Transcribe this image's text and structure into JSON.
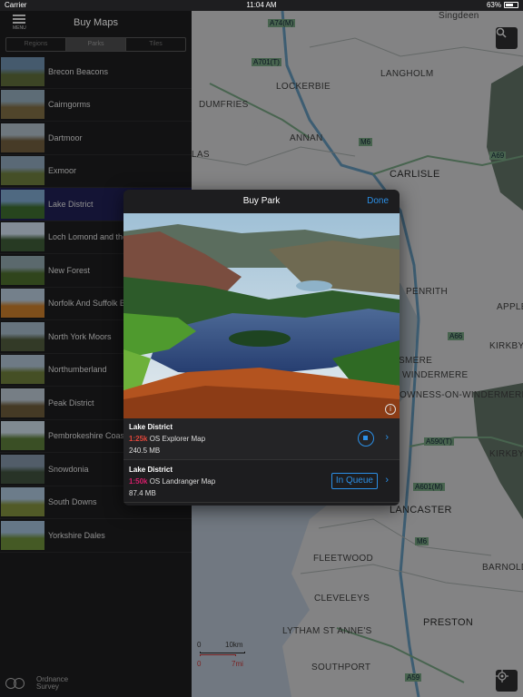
{
  "status_bar": {
    "carrier": "Carrier",
    "time": "11:04 AM",
    "battery": "63%"
  },
  "sidebar": {
    "menu_label": "MENU",
    "title": "Buy Maps",
    "segments": [
      "Regions",
      "Parks",
      "Tiles"
    ],
    "active_segment": "Parks",
    "items": [
      {
        "label": "Brecon Beacons"
      },
      {
        "label": "Cairngorms"
      },
      {
        "label": "Dartmoor"
      },
      {
        "label": "Exmoor"
      },
      {
        "label": "Lake District"
      },
      {
        "label": "Loch Lomond and the Trossachs"
      },
      {
        "label": "New Forest"
      },
      {
        "label": "Norfolk And Suffolk Broads"
      },
      {
        "label": "North York Moors"
      },
      {
        "label": "Northumberland"
      },
      {
        "label": "Peak District"
      },
      {
        "label": "Pembrokeshire Coast"
      },
      {
        "label": "Snowdonia"
      },
      {
        "label": "South Downs"
      },
      {
        "label": "Yorkshire Dales"
      }
    ],
    "selected_item": "Lake District",
    "logo_line1": "Ordnance",
    "logo_line2": "Survey"
  },
  "map": {
    "labels": {
      "singleen": "Singdeen",
      "langholm": "LANGHOLM",
      "lockerbie": "LOCKERBIE",
      "dumfries": "DUMFRIES",
      "annan": "ANNAN",
      "carlisle": "CARLISLE",
      "penrith": "PENRITH",
      "appleby": "APPLEB",
      "kirkby_stephen": "KIRKBY S",
      "windermere": "WINDERMERE",
      "bowness": "OWNESS-ON-WINDERMERE",
      "kirkby_lonsdale": "KIRKBY L",
      "lancaster": "LANCASTER",
      "fleetwood": "FLEETWOOD",
      "barnold": "BARNOLD",
      "cleveleys": "CLEVELEYS",
      "preston": "PRESTON",
      "lytham": "LYTHAM ST ANNE'S",
      "southport": "SOUTHPORT",
      "grasmere": "SMERE",
      "las": "LAS"
    },
    "roads": [
      "A74(M)",
      "A701(T)",
      "M6",
      "A69",
      "A590(T)",
      "A601(M)",
      "M6",
      "A59",
      "A66"
    ],
    "scale_km": "10km",
    "scale_mi": "7mi",
    "scale_zero_km": "0",
    "scale_zero_mi": "0"
  },
  "modal": {
    "title": "Buy Park",
    "done_label": "Done",
    "products": [
      {
        "name": "Lake District",
        "scale": "1:25k",
        "map_type": "OS Explorer Map",
        "size": "240.5 MB",
        "status": "downloading"
      },
      {
        "name": "Lake District",
        "scale": "1:50k",
        "map_type": "OS Landranger Map",
        "size": "87.4 MB",
        "status": "In Queue"
      }
    ]
  },
  "colors": {
    "accent": "#2b8fe6",
    "explorer_scale": "#e0463b",
    "landranger_scale": "#d61e6b",
    "selected_row": "#1f1f52"
  }
}
